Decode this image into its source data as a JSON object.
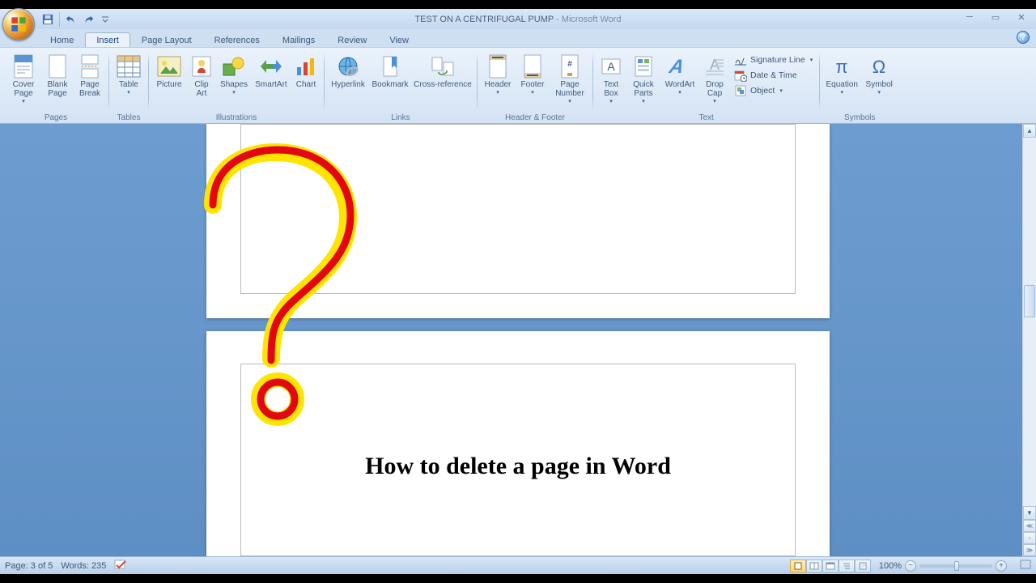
{
  "title": {
    "document": "TEST ON A CENTRIFUGAL PUMP",
    "app": "Microsoft Word"
  },
  "tabs": [
    "Home",
    "Insert",
    "Page Layout",
    "References",
    "Mailings",
    "Review",
    "View"
  ],
  "active_tab": "Insert",
  "ribbon": {
    "pages": {
      "label": "Pages",
      "cover_page": "Cover\nPage",
      "blank_page": "Blank\nPage",
      "page_break": "Page\nBreak"
    },
    "tables": {
      "label": "Tables",
      "table": "Table"
    },
    "illustrations": {
      "label": "Illustrations",
      "picture": "Picture",
      "clip_art": "Clip\nArt",
      "shapes": "Shapes",
      "smartart": "SmartArt",
      "chart": "Chart"
    },
    "links": {
      "label": "Links",
      "hyperlink": "Hyperlink",
      "bookmark": "Bookmark",
      "cross_reference": "Cross-reference"
    },
    "header_footer": {
      "label": "Header & Footer",
      "header": "Header",
      "footer": "Footer",
      "page_number": "Page\nNumber"
    },
    "text": {
      "label": "Text",
      "text_box": "Text\nBox",
      "quick_parts": "Quick\nParts",
      "wordart": "WordArt",
      "drop_cap": "Drop\nCap",
      "signature": "Signature Line",
      "date_time": "Date & Time",
      "object": "Object"
    },
    "symbols": {
      "label": "Symbols",
      "equation": "Equation",
      "symbol": "Symbol"
    }
  },
  "page_content": {
    "heading": "How to delete a page in Word"
  },
  "status": {
    "page": "Page: 3 of 5",
    "words": "Words: 235",
    "zoom": "100%"
  }
}
